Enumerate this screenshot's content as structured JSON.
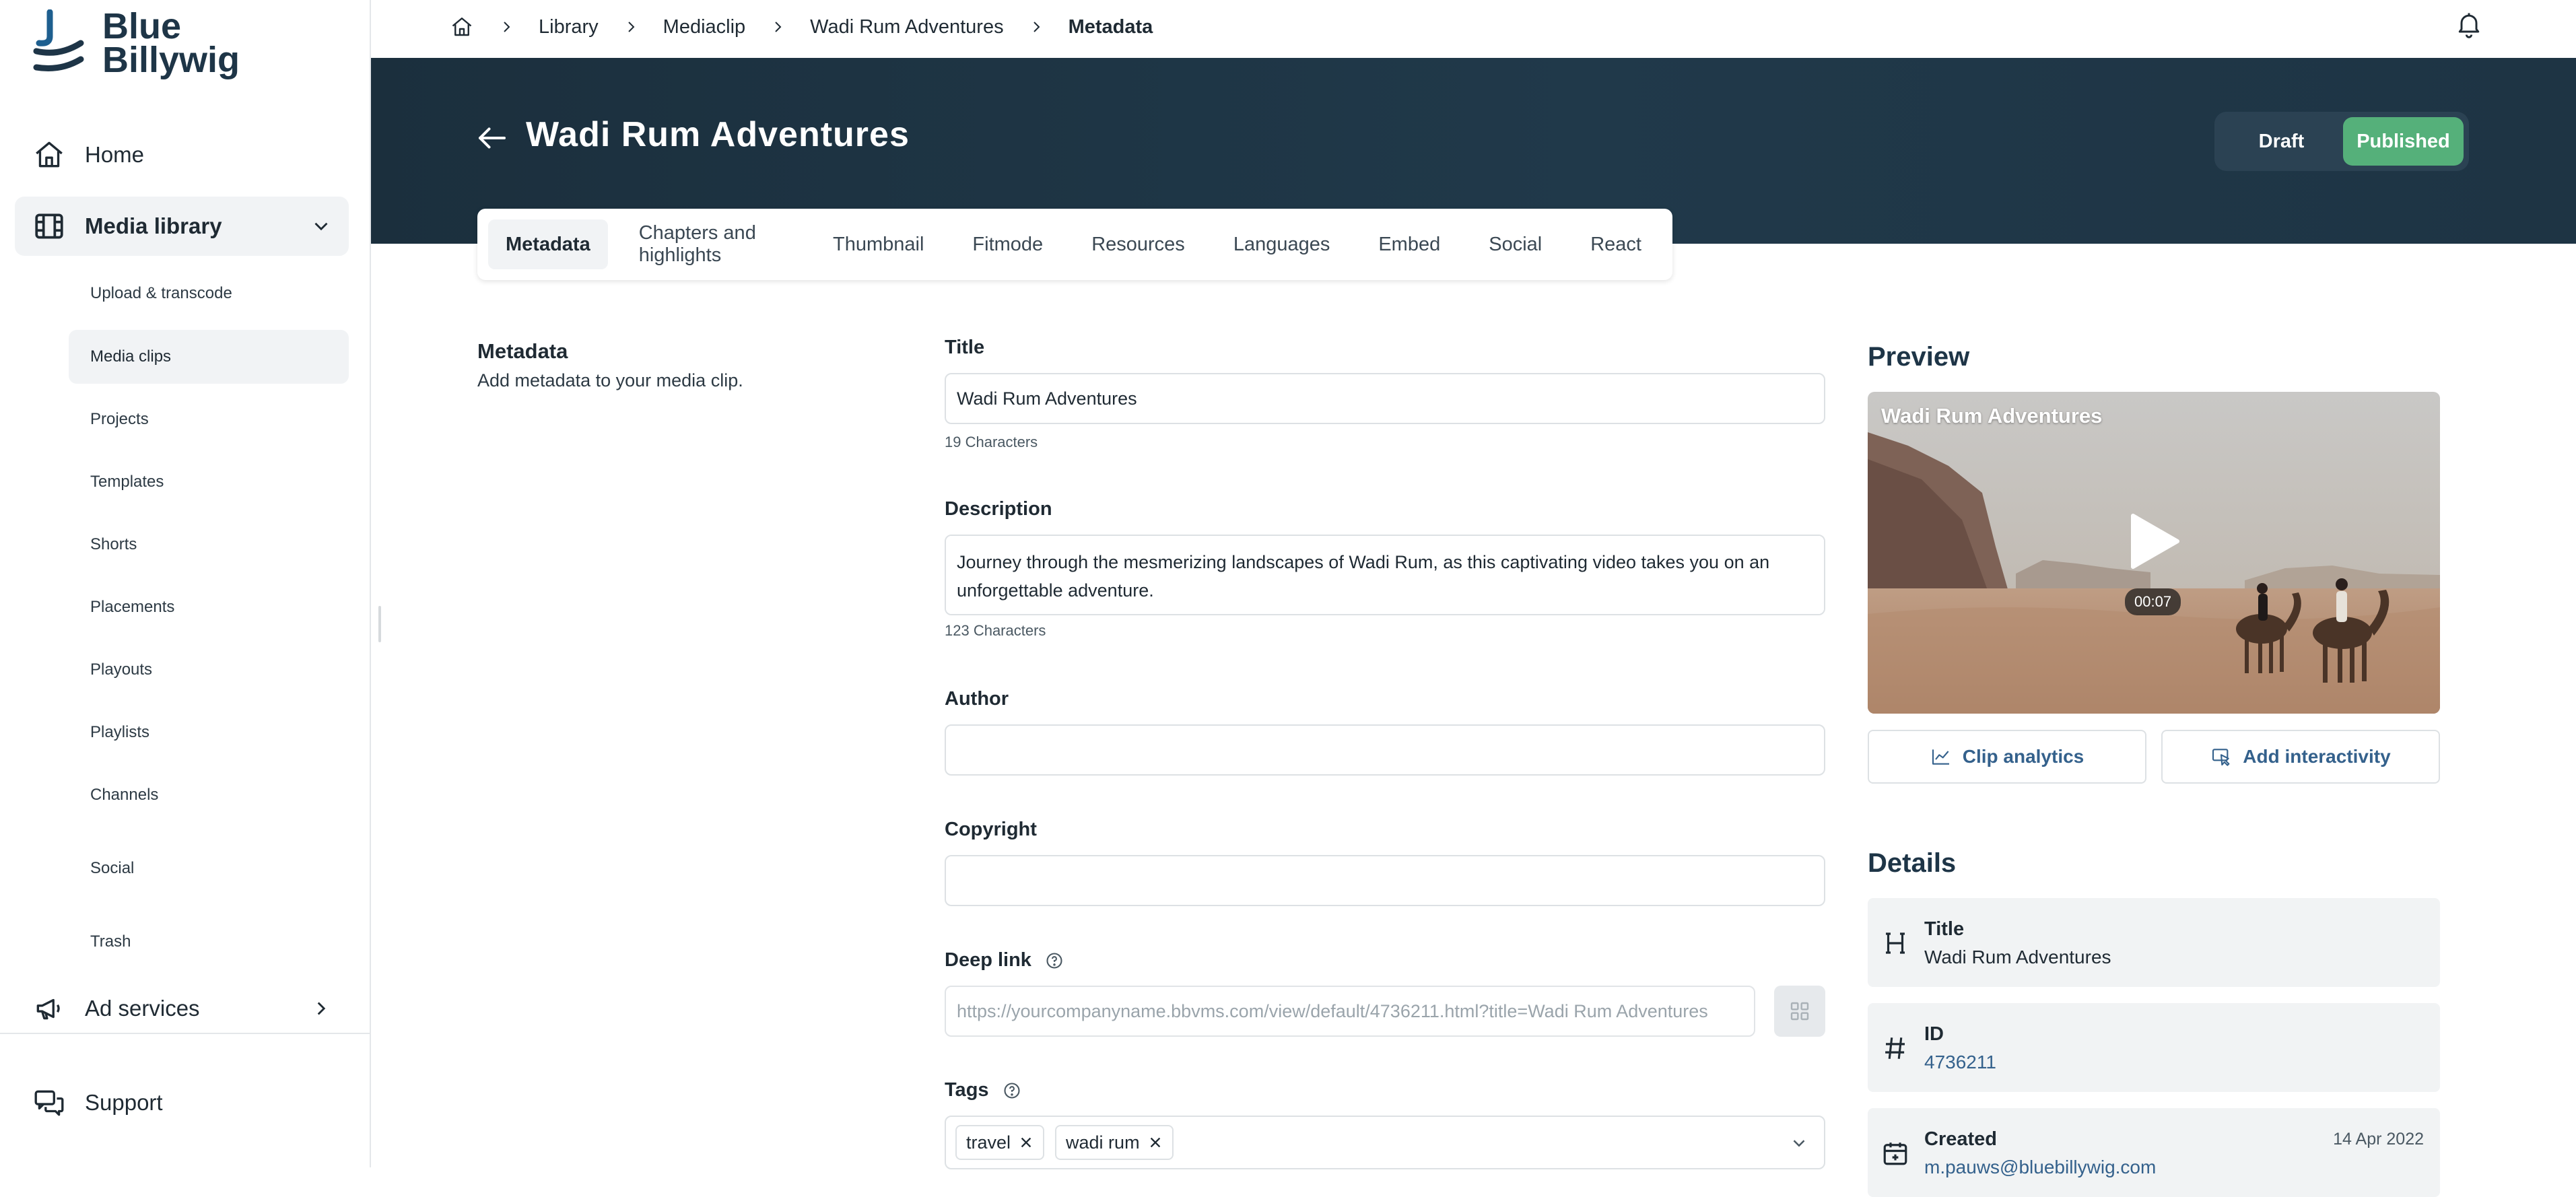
{
  "brand": {
    "name_line1": "Blue",
    "name_line2": "Billywig",
    "icon": "blue-billywig-logo"
  },
  "sidebar": {
    "home": {
      "label": "Home",
      "icon": "home-icon"
    },
    "media_library": {
      "label": "Media library",
      "icon": "film-icon",
      "expanded": true
    },
    "sub_items": [
      {
        "label": "Upload & transcode"
      },
      {
        "label": "Media clips",
        "active": true
      },
      {
        "label": "Projects"
      },
      {
        "label": "Templates"
      },
      {
        "label": "Shorts"
      },
      {
        "label": "Placements"
      },
      {
        "label": "Playouts"
      },
      {
        "label": "Playlists"
      },
      {
        "label": "Channels"
      },
      {
        "label": "Social"
      },
      {
        "label": "Trash"
      }
    ],
    "ad_services": {
      "label": "Ad services",
      "icon": "megaphone-icon"
    },
    "support": {
      "label": "Support",
      "icon": "support-chat-icon"
    }
  },
  "breadcrumb": [
    "Library",
    "Mediaclip",
    "Wadi Rum Adventures",
    "Metadata"
  ],
  "header": {
    "title": "Wadi Rum Adventures",
    "status": {
      "draft": "Draft",
      "published": "Published",
      "selected": "Published"
    }
  },
  "tabs": [
    {
      "label": "Metadata",
      "active": true
    },
    {
      "label": "Chapters and highlights"
    },
    {
      "label": "Thumbnail"
    },
    {
      "label": "Fitmode"
    },
    {
      "label": "Resources"
    },
    {
      "label": "Languages"
    },
    {
      "label": "Embed"
    },
    {
      "label": "Social"
    },
    {
      "label": "React"
    }
  ],
  "metadata_section": {
    "title": "Metadata",
    "subtitle": "Add metadata to your media clip."
  },
  "form": {
    "title": {
      "label": "Title",
      "value": "Wadi Rum Adventures",
      "count": "19 Characters"
    },
    "description": {
      "label": "Description",
      "value": "Journey through the mesmerizing landscapes of Wadi Rum, as this captivating video takes you on an unforgettable adventure.",
      "count": "123 Characters"
    },
    "author": {
      "label": "Author",
      "value": ""
    },
    "copyright": {
      "label": "Copyright",
      "value": ""
    },
    "deep_link": {
      "label": "Deep link",
      "value": "https://yourcompanyname.bbvms.com/view/default/4736211.html?title=Wadi Rum Adventures"
    },
    "tags": {
      "label": "Tags",
      "items": [
        "travel",
        "wadi rum"
      ]
    }
  },
  "preview": {
    "heading": "Preview",
    "video_title": "Wadi Rum Adventures",
    "duration": "00:07",
    "clip_analytics": "Clip analytics",
    "add_interactivity": "Add interactivity"
  },
  "details": {
    "heading": "Details",
    "items": [
      {
        "label": "Title",
        "value": "Wadi Rum Adventures",
        "icon": "heading-icon"
      },
      {
        "label": "ID",
        "value": "4736211",
        "icon": "hash-icon"
      },
      {
        "label": "Created",
        "value": "m.pauws@bluebillywig.com",
        "date": "14 Apr 2022",
        "icon": "calendar-plus-icon"
      }
    ]
  },
  "colors": {
    "banner": "#1b2f3d",
    "published": "#55b07a",
    "accent_link": "#34618c",
    "sidebar_active": "#f1f3f5"
  }
}
